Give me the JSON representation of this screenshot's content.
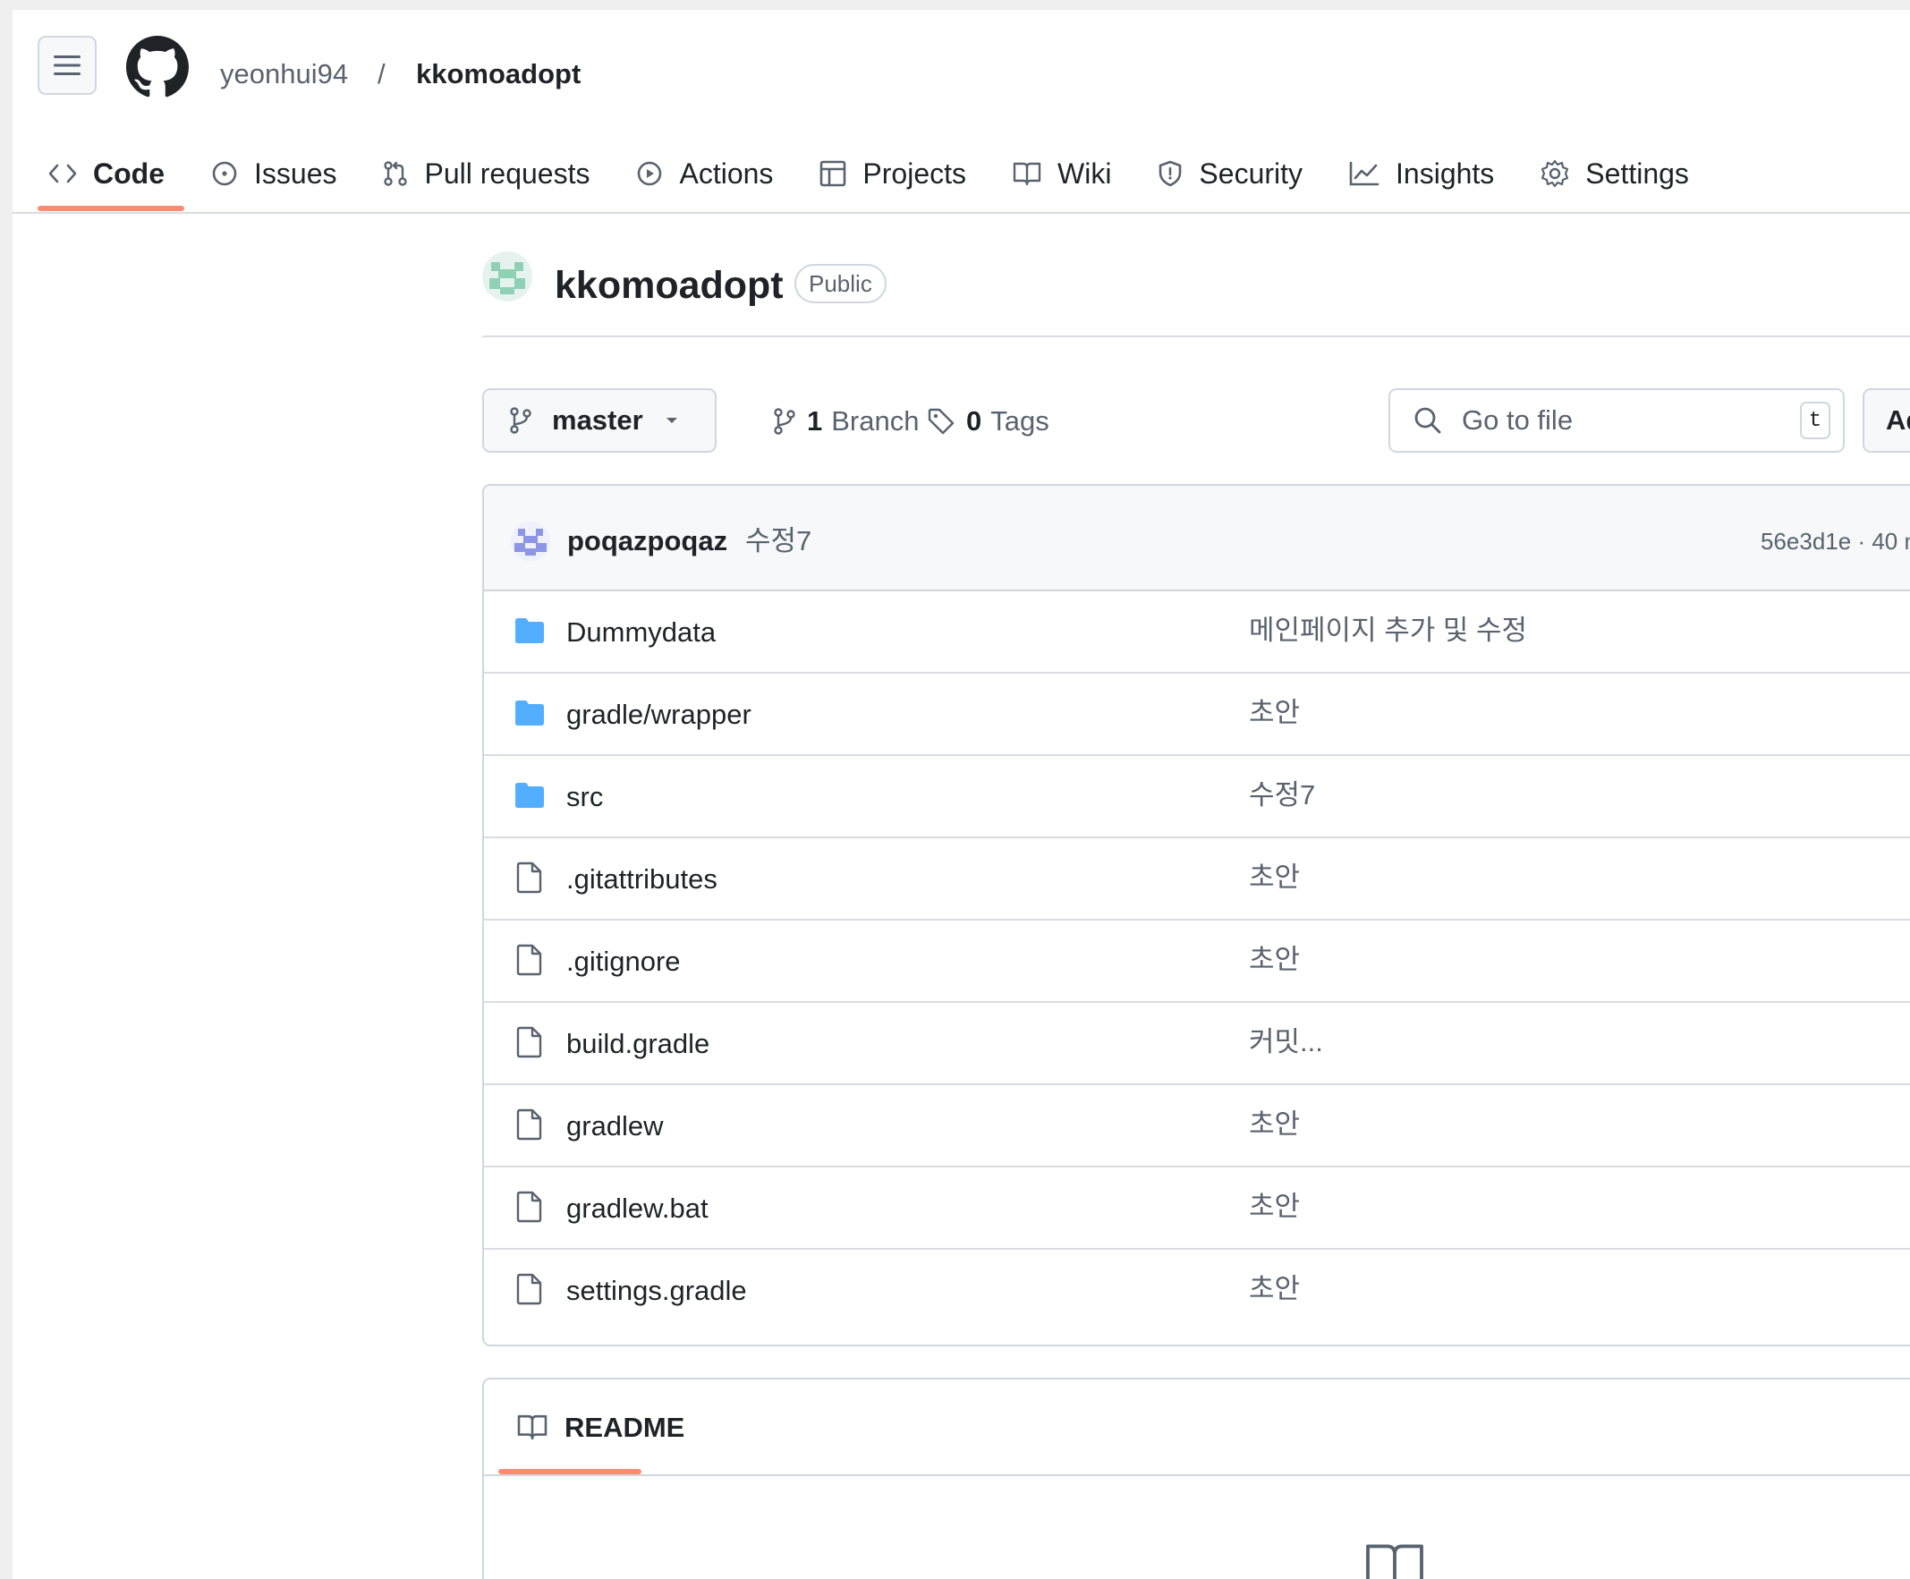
{
  "header": {
    "owner": "yeonhui94",
    "separator": "/",
    "repo": "kkomoadopt"
  },
  "tabs": [
    {
      "label": "Code",
      "icon": "code-icon",
      "active": true
    },
    {
      "label": "Issues",
      "icon": "issue-icon"
    },
    {
      "label": "Pull requests",
      "icon": "pull-request-icon"
    },
    {
      "label": "Actions",
      "icon": "play-icon"
    },
    {
      "label": "Projects",
      "icon": "table-icon"
    },
    {
      "label": "Wiki",
      "icon": "book-icon"
    },
    {
      "label": "Security",
      "icon": "shield-icon"
    },
    {
      "label": "Insights",
      "icon": "graph-icon"
    },
    {
      "label": "Settings",
      "icon": "gear-icon"
    }
  ],
  "repo_heading": {
    "title": "kkomoadopt",
    "visibility": "Public"
  },
  "branch_bar": {
    "branch": "master",
    "branches_count": "1",
    "branches_label": "Branch",
    "tags_count": "0",
    "tags_label": "Tags",
    "goto_placeholder": "Go to file",
    "goto_shortcut": "t",
    "add_label": "Ad"
  },
  "latest_commit": {
    "author": "poqazpoqaz",
    "message": "수정7",
    "meta": "56e3d1e · 40 m"
  },
  "files": [
    {
      "name": "Dummydata",
      "type": "folder",
      "message": "메인페이지 추가 및 수정"
    },
    {
      "name": "gradle/wrapper",
      "type": "folder",
      "message": "초안"
    },
    {
      "name": "src",
      "type": "folder",
      "message": "수정7"
    },
    {
      "name": ".gitattributes",
      "type": "file",
      "message": "초안"
    },
    {
      "name": ".gitignore",
      "type": "file",
      "message": "초안"
    },
    {
      "name": "build.gradle",
      "type": "file",
      "message": "커밋..."
    },
    {
      "name": "gradlew",
      "type": "file",
      "message": "초안"
    },
    {
      "name": "gradlew.bat",
      "type": "file",
      "message": "초안"
    },
    {
      "name": "settings.gradle",
      "type": "file",
      "message": "초안"
    }
  ],
  "readme": {
    "label": "README"
  },
  "colors": {
    "accent_underline": "#fd8c73",
    "folder": "#54aeff",
    "muted_text": "#59636e"
  }
}
